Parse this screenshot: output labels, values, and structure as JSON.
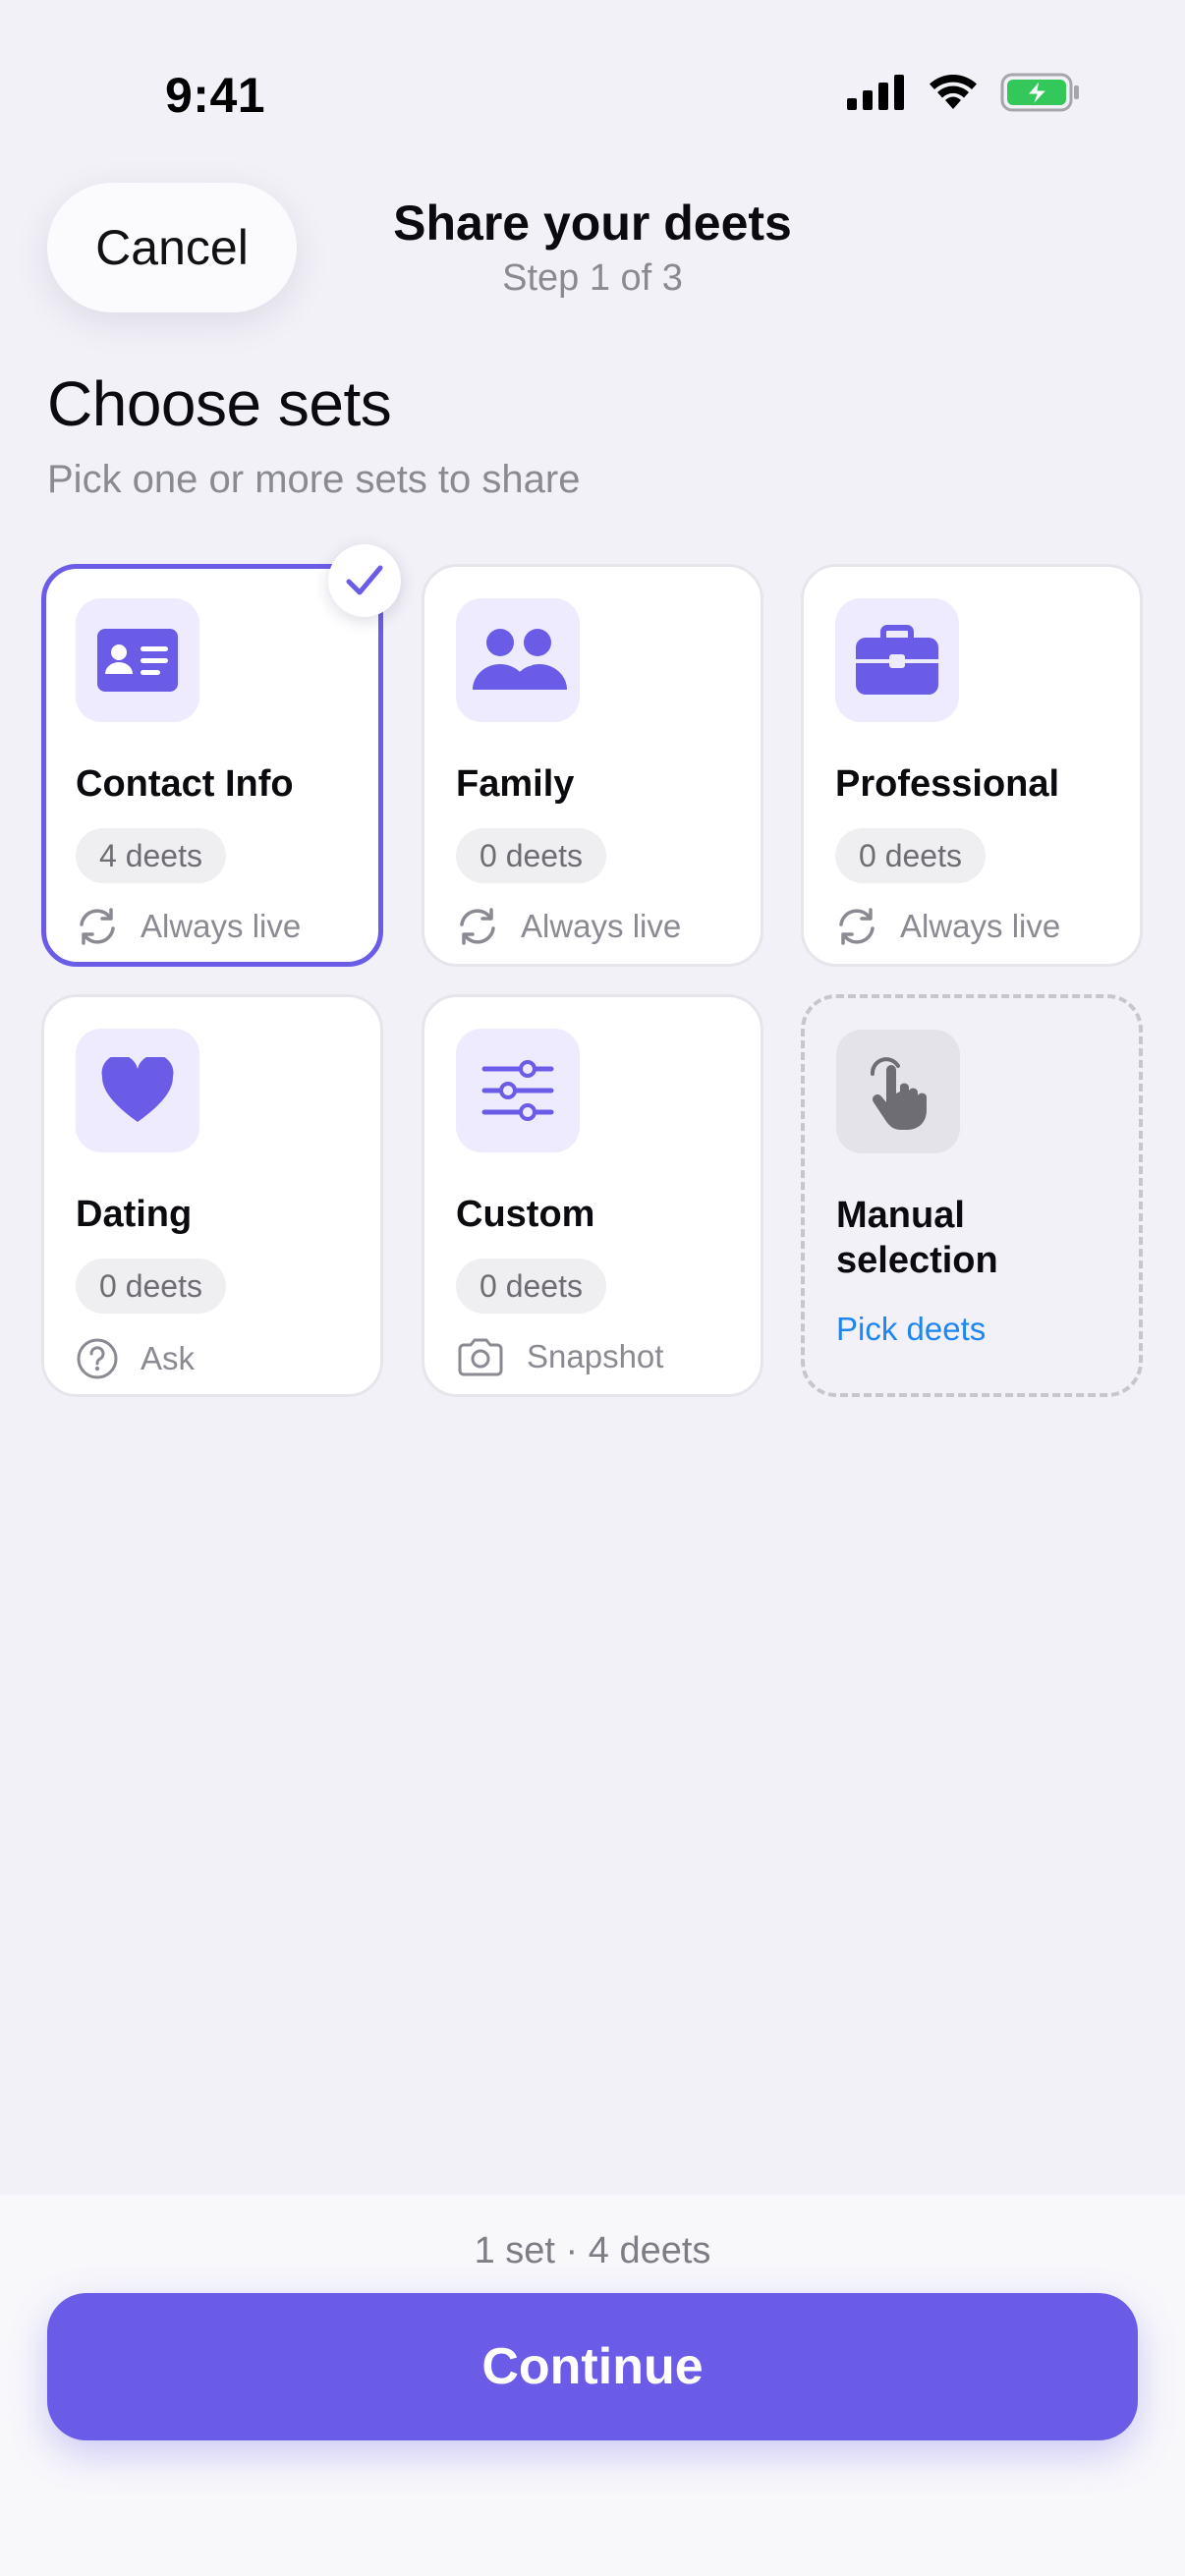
{
  "status_bar": {
    "time": "9:41"
  },
  "header": {
    "cancel_label": "Cancel",
    "title": "Share your deets",
    "subtitle": "Step 1 of 3"
  },
  "section": {
    "title": "Choose sets",
    "subtitle": "Pick one or more sets to share"
  },
  "sets": [
    {
      "title": "Contact Info",
      "count": "4 deets",
      "mode": "Always live",
      "mode_icon": "sync-icon",
      "icon": "contact-card-icon",
      "selected": true
    },
    {
      "title": "Family",
      "count": "0 deets",
      "mode": "Always live",
      "mode_icon": "sync-icon",
      "icon": "people-icon",
      "selected": false
    },
    {
      "title": "Professional",
      "count": "0 deets",
      "mode": "Always live",
      "mode_icon": "sync-icon",
      "icon": "briefcase-icon",
      "selected": false
    },
    {
      "title": "Dating",
      "count": "0 deets",
      "mode": "Ask",
      "mode_icon": "question-icon",
      "icon": "heart-icon",
      "selected": false
    },
    {
      "title": "Custom",
      "count": "0 deets",
      "mode": "Snapshot",
      "mode_icon": "camera-icon",
      "icon": "sliders-icon",
      "selected": false
    }
  ],
  "manual": {
    "title": "Manual selection",
    "link": "Pick deets",
    "icon": "hand-pointer-icon"
  },
  "footer": {
    "summary": "1 set · 4 deets",
    "continue_label": "Continue"
  },
  "colors": {
    "accent": "#6b5ce7",
    "link": "#1f86f0",
    "battery": "#34c759"
  }
}
